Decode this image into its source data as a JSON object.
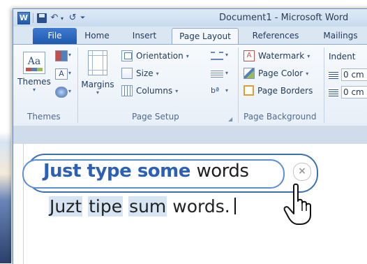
{
  "app": {
    "logo_letter": "W",
    "title": "Document1 - Microsoft Word"
  },
  "quick_access": {
    "undo_glyph": "↶",
    "redo_glyph": "↺",
    "customize_glyph": "⏷"
  },
  "tabs": [
    {
      "label": "File"
    },
    {
      "label": "Home"
    },
    {
      "label": "Insert"
    },
    {
      "label": "Page Layout"
    },
    {
      "label": "References"
    },
    {
      "label": "Mailings"
    }
  ],
  "ribbon": {
    "themes": {
      "button_label": "Themes",
      "icon_text": "Aa",
      "fonts_icon_text": "A",
      "group_label": "Themes"
    },
    "page_setup": {
      "margins_label": "Margins",
      "orientation_label": "Orientation",
      "size_label": "Size",
      "columns_label": "Columns",
      "hyphenation_glyph": "bª",
      "group_label": "Page Setup"
    },
    "page_background": {
      "watermark_label": "Watermark",
      "page_color_label": "Page Color",
      "page_borders_label": "Page Borders",
      "watermark_icon_text": "A",
      "group_label": "Page Background"
    },
    "paragraph": {
      "indent_label": "Indent",
      "left_value": "0 cm",
      "right_value": "0 cm"
    }
  },
  "document": {
    "callout_bold": "Just type some ",
    "callout_plain": "words",
    "close_glyph": "×",
    "typed_words": [
      "Juzt",
      "tipe",
      "sum",
      "words."
    ]
  },
  "colors": {
    "accent_blue": "#2b60b8",
    "file_tab": "#2d6bc4",
    "misspell_highlight": "#d6e4f3"
  }
}
